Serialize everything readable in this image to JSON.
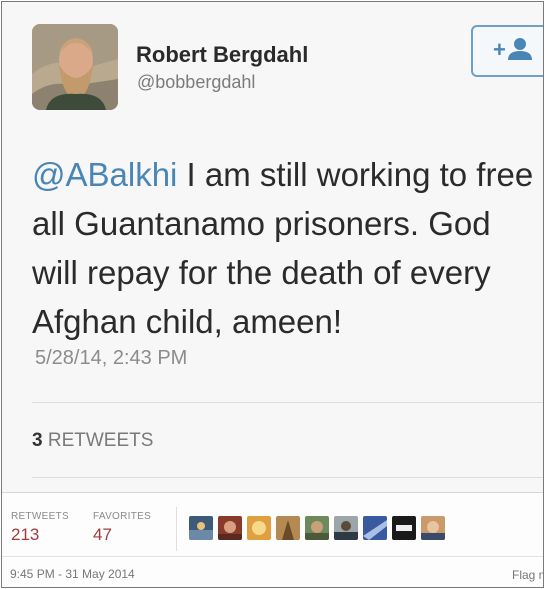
{
  "profile": {
    "display_name": "Robert Bergdahl",
    "handle": "@bobbergdahl",
    "follow_icon": "add-user-icon",
    "follow_glyph": "+"
  },
  "tweet": {
    "mention": "@ABalkhi",
    "line1_rest": " I am still working to free",
    "line2": "all Guantanamo prisoners. God",
    "line3": "will repay for the death of every",
    "line4": "Afghan child, ameen!",
    "timestamp": "5/28/14, 2:43 PM",
    "accent_color": "#4a86b5"
  },
  "retweets_summary": {
    "count": "3",
    "label": "RETWEETS"
  },
  "stats": {
    "retweets_label": "RETWEETS",
    "retweets_value": "213",
    "favorites_label": "FAVORITES",
    "favorites_value": "47"
  },
  "footer": {
    "time": "9:45 PM - 31 May 2014",
    "flag": "Flag m"
  }
}
